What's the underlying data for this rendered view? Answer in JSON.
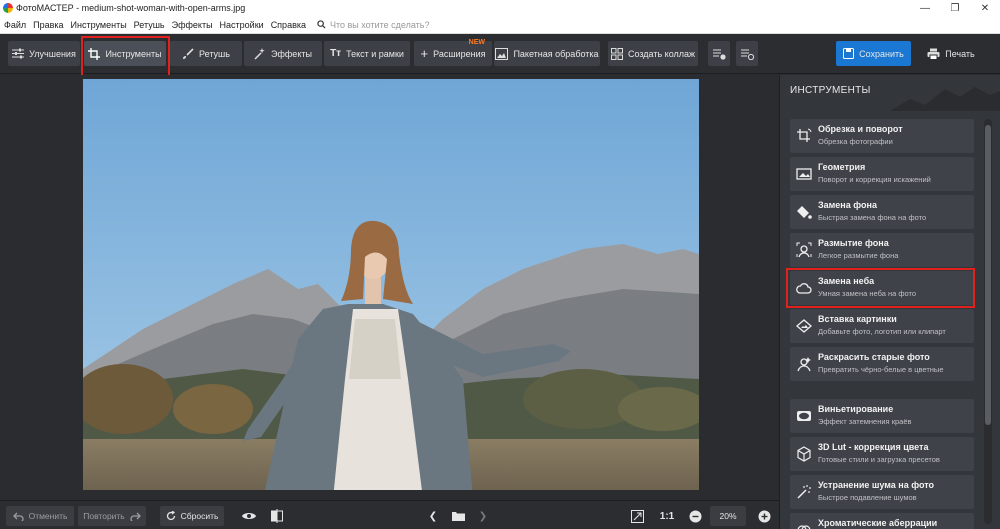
{
  "titlebar": {
    "title": "ФотоМАСТЕР - medium-shot-woman-with-open-arms.jpg",
    "minimize": "—",
    "maximize": "❐",
    "close": "✕"
  },
  "menu": {
    "items": [
      "Файл",
      "Правка",
      "Инструменты",
      "Ретушь",
      "Эффекты",
      "Настройки",
      "Справка"
    ],
    "search_placeholder": "Что вы хотите сделать?"
  },
  "toolbar": {
    "improve": "Улучшения",
    "tools": "Инструменты",
    "retouch": "Ретушь",
    "effects": "Эффекты",
    "text_frames": "Текст и рамки",
    "extensions": "Расширения",
    "new_badge": "NEW",
    "batch": "Пакетная обработка",
    "collage": "Создать коллаж",
    "save": "Сохранить",
    "print": "Печать"
  },
  "sidebar": {
    "header": "ИНСТРУМЕНТЫ",
    "tools": [
      {
        "name": "Обрезка и поворот",
        "desc": "Обрезка фотографии",
        "icon": "crop-rotate-icon"
      },
      {
        "name": "Геометрия",
        "desc": "Поворот и коррекция искажений",
        "icon": "geometry-icon"
      },
      {
        "name": "Замена фона",
        "desc": "Быстрая замена фона на фото",
        "icon": "paint-bucket-icon"
      },
      {
        "name": "Размытие фона",
        "desc": "Легкое размытие фона",
        "icon": "blur-portrait-icon"
      },
      {
        "name": "Замена неба",
        "desc": "Умная замена неба на фото",
        "icon": "cloud-icon"
      },
      {
        "name": "Вставка картинки",
        "desc": "Добавьте фото, логотип или клипарт",
        "icon": "insert-image-icon"
      },
      {
        "name": "Раскрасить старые фото",
        "desc": "Превратить чёрно-белые в цветные",
        "icon": "colorize-icon"
      },
      {
        "name": "Виньетирование",
        "desc": "Эффект затемнения краёв",
        "icon": "vignette-icon"
      },
      {
        "name": "3D Lut - коррекция цвета",
        "desc": "Готовые стили и загрузка пресетов",
        "icon": "lut-cube-icon"
      },
      {
        "name": "Устранение шума на фото",
        "desc": "Быстрое подавление шумов",
        "icon": "denoise-icon"
      },
      {
        "name": "Хроматические аберрации",
        "desc": "",
        "icon": "chromatic-icon"
      }
    ]
  },
  "bottombar": {
    "undo": "Отменить",
    "redo": "Повторить",
    "reset": "Сбросить",
    "fit": "1:1",
    "zoom": "20%"
  },
  "colors": {
    "accent_blue": "#1a77d2",
    "highlight_red": "#e0211d",
    "new_badge": "#ff7a21"
  }
}
